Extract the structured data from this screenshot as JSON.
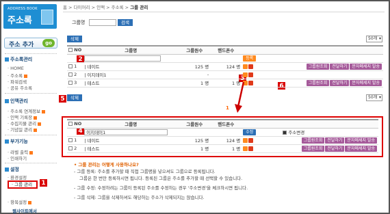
{
  "sidebar": {
    "logo_small": "ADDRESS BOOK",
    "logo_title": "주소록",
    "add_button": "주소 추가",
    "add_go": "go",
    "sections": [
      {
        "title": "주소록관리",
        "items": [
          "HOME",
          "주소록",
          "파워검색",
          "공유 주소록"
        ]
      },
      {
        "title": "인맥관리",
        "items": [
          "주소록 연계정보",
          "인맥 기록장",
          "수집지물 관리",
          "기념일 관리"
        ]
      },
      {
        "title": "부가기능",
        "items": [
          "라벨 출력",
          "인쇄하기"
        ]
      },
      {
        "title": "설정",
        "items": [
          "환경설정"
        ]
      }
    ],
    "selected_item": "그룹 관리",
    "bottom_item": "항목설정",
    "bottom_text": "웹사이트에서"
  },
  "breadcrumb": {
    "home": "홈",
    "parts": [
      "다이어리",
      "인맥",
      "주소록"
    ],
    "current": "그룹 관리"
  },
  "search": {
    "label": "그룹명",
    "value": "",
    "button": "검색"
  },
  "toolbar": {
    "delete": "삭제",
    "per_page": "50개"
  },
  "table1": {
    "headers": [
      "NO",
      "그룹명",
      "그룹원수",
      "핸드폰수"
    ],
    "new_row_button": "등록",
    "rows": [
      {
        "no": "1",
        "name": "네이트",
        "members": "125 명",
        "phones": "124 명"
      },
      {
        "no": "2",
        "name": "이지데이1",
        "members": "-",
        "phones": "-"
      },
      {
        "no": "3",
        "name": "테스트",
        "members": "1 명",
        "phones": "1 명"
      }
    ],
    "actions": [
      "그룹원조회",
      "전달하기",
      "문자메세지 발송"
    ]
  },
  "pager": "1",
  "table2": {
    "headers": [
      "NO",
      "그룹명",
      "그룹원수",
      "핸드폰수"
    ],
    "edit_value": "이지데이1",
    "edit_button": "수정",
    "address_change": "주소변경",
    "rows": [
      {
        "no": "1",
        "name": "네이트",
        "members": "125 명",
        "phones": "124 명"
      },
      {
        "no": "2",
        "name": "테스트",
        "members": "1 명",
        "phones": "1 명"
      }
    ],
    "actions": [
      "그룹원조회",
      "전달하기",
      "문자메세지 발송"
    ]
  },
  "callouts": [
    "1",
    "2",
    "3",
    "4",
    "5",
    "6"
  ],
  "help": {
    "title": "• 그룹 관리는 어떻게 사용하나요?",
    "lines": [
      "- 그룹 등록: 주소를 추가할 때 직접 그룹명을 넣으셔도 그룹으로 등록됩니다.",
      "  그룹은 한 번만 등록하시면 됩니다. 등록된 그룹은 주소를 추가할 때 선택할 수 있습니다.",
      "- 그룹 수정: 수정하려는 그룹이 등록된 주소를 수정하는 경우 '주소변경'을 체크하시면 됩니다.",
      "- 그룹 삭제: 그룹을 삭제하셔도 해당하는 주소가 삭제되지는 않습니다."
    ]
  }
}
